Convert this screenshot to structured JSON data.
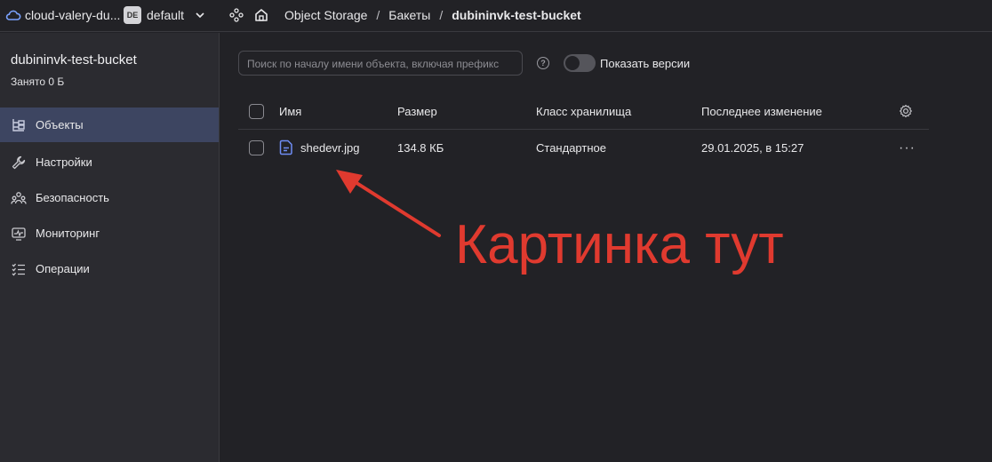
{
  "topbar": {
    "cloud_label": "cloud-valery-du...",
    "folder_badge": "DE",
    "folder_label": "default",
    "breadcrumbs": [
      "Object Storage",
      "Бакеты",
      "dubininvk-test-bucket"
    ]
  },
  "sidebar": {
    "bucket_name": "dubininvk-test-bucket",
    "used": "Занято 0 Б",
    "items": [
      {
        "label": "Объекты",
        "icon": "objects-icon",
        "active": true
      },
      {
        "label": "Настройки",
        "icon": "wrench-icon",
        "active": false
      },
      {
        "label": "Безопасность",
        "icon": "users-icon",
        "active": false
      },
      {
        "label": "Мониторинг",
        "icon": "monitor-icon",
        "active": false
      },
      {
        "label": "Операции",
        "icon": "list-icon",
        "active": false
      }
    ]
  },
  "toolbar": {
    "search_placeholder": "Поиск по началу имени объекта, включая префикс",
    "show_versions_label": "Показать версии",
    "show_versions_on": false
  },
  "table": {
    "columns": [
      "Имя",
      "Размер",
      "Класс хранилища",
      "Последнее изменение"
    ],
    "rows": [
      {
        "name": "shedevr.jpg",
        "size": "134.8 КБ",
        "storage_class": "Стандартное",
        "modified": "29.01.2025, в 15:27"
      }
    ]
  },
  "annotation": {
    "text": "Картинка тут",
    "color": "#e03a2f"
  }
}
